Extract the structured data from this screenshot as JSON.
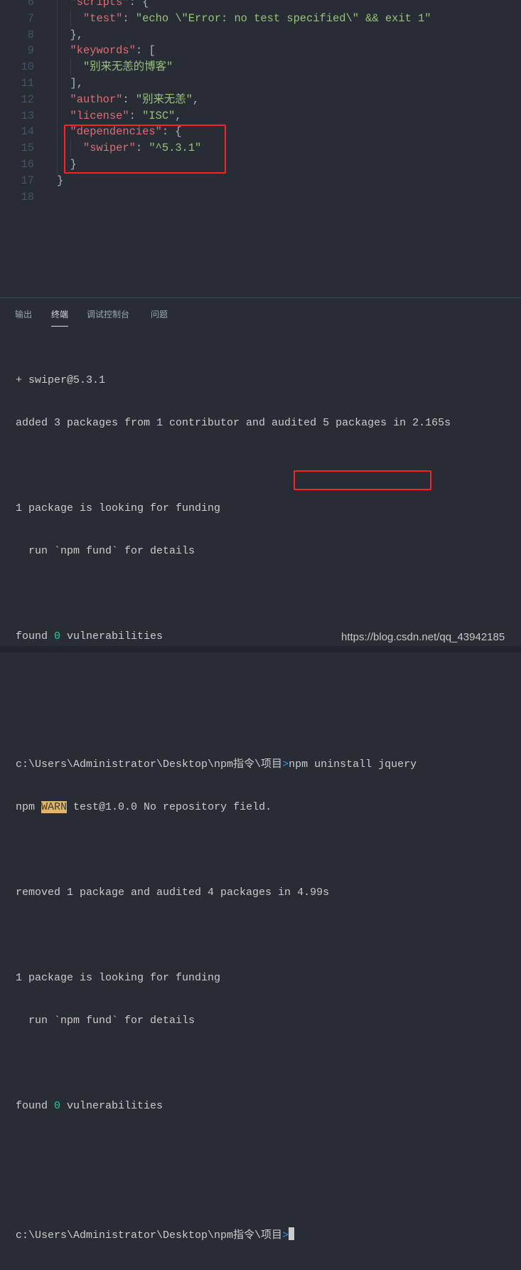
{
  "editor": {
    "lines": [
      {
        "n": "6",
        "parts": [
          [
            "k",
            "\"scripts\""
          ],
          [
            "p",
            ": {"
          ]
        ],
        "indent": 1
      },
      {
        "n": "7",
        "parts": [
          [
            "k",
            "\"test\""
          ],
          [
            "p",
            ": "
          ],
          [
            "s",
            "\"echo \\\"Error: no test specified\\\" && exit 1\""
          ]
        ],
        "indent": 2
      },
      {
        "n": "8",
        "parts": [
          [
            "p",
            "},"
          ]
        ],
        "indent": 1
      },
      {
        "n": "9",
        "parts": [
          [
            "k",
            "\"keywords\""
          ],
          [
            "p",
            ": ["
          ]
        ],
        "indent": 1
      },
      {
        "n": "10",
        "parts": [
          [
            "s",
            "\"别来无恙的博客\""
          ]
        ],
        "indent": 2
      },
      {
        "n": "11",
        "parts": [
          [
            "p",
            "],"
          ]
        ],
        "indent": 1
      },
      {
        "n": "12",
        "parts": [
          [
            "k",
            "\"author\""
          ],
          [
            "p",
            ": "
          ],
          [
            "s",
            "\"别来无恙\""
          ],
          [
            "p",
            ","
          ]
        ],
        "indent": 1
      },
      {
        "n": "13",
        "parts": [
          [
            "k",
            "\"license\""
          ],
          [
            "p",
            ": "
          ],
          [
            "s",
            "\"ISC\""
          ],
          [
            "p",
            ","
          ]
        ],
        "indent": 1
      },
      {
        "n": "14",
        "parts": [
          [
            "k",
            "\"dependencies\""
          ],
          [
            "p",
            ": {"
          ]
        ],
        "indent": 1
      },
      {
        "n": "15",
        "parts": [
          [
            "k",
            "\"swiper\""
          ],
          [
            "p",
            ": "
          ],
          [
            "s",
            "\"^5.3.1\""
          ]
        ],
        "indent": 2
      },
      {
        "n": "16",
        "parts": [
          [
            "p",
            "}"
          ]
        ],
        "indent": 1
      },
      {
        "n": "17",
        "parts": [
          [
            "p",
            "}"
          ]
        ],
        "indent": 0
      },
      {
        "n": "18",
        "parts": [],
        "indent": 0
      }
    ]
  },
  "panel": {
    "tabs": [
      {
        "label": "输出",
        "active": false
      },
      {
        "label": "终端",
        "active": true
      },
      {
        "label": "调试控制台",
        "active": false
      },
      {
        "label": "问题",
        "active": false
      }
    ]
  },
  "terminal": {
    "l1": "+ swiper@5.3.1",
    "l2": "added 3 packages from 1 contributor and audited 5 packages in 2.165s",
    "l3": "1 package is looking for funding",
    "l4": "  run `npm fund` for details",
    "l5a": "found ",
    "l5b": "0",
    "l5c": " vulnerabilities",
    "prompt": "c:\\Users\\Administrator\\Desktop\\npm指令\\项目",
    "prompt_symbol": ">",
    "command": "npm uninstall jquery",
    "w1": "npm ",
    "w2": "WARN",
    "w3": " test@1.0.0 No repository field.",
    "l6": "removed 1 package and audited 4 packages in 4.99s",
    "l7": "1 package is looking for funding",
    "l8": "  run `npm fund` for details",
    "l9a": "found ",
    "l9b": "0",
    "l9c": " vulnerabilities",
    "prompt2": "c:\\Users\\Administrator\\Desktop\\npm指令\\项目",
    "prompt2_symbol": ">"
  },
  "watermark": "https://blog.csdn.net/qq_43942185",
  "colors": {
    "key": "#e06c75",
    "string": "#98c379",
    "highlight_box": "#ff2020",
    "warn_bg": "#e5b567"
  }
}
